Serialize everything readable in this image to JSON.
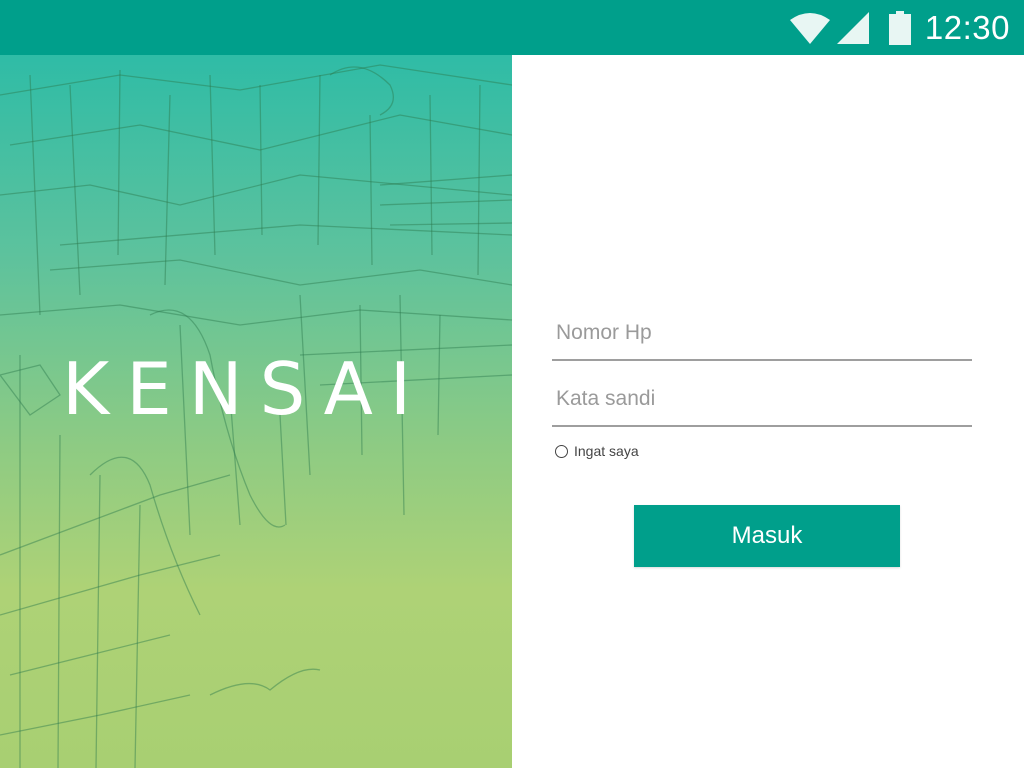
{
  "status_bar": {
    "time": "12:30",
    "icons": [
      "wifi-icon",
      "signal-icon",
      "battery-icon"
    ],
    "color": "#009f8b"
  },
  "hero": {
    "logo_text": "KENSAI",
    "gradient_colors": [
      "#2fbca6",
      "#aed276"
    ]
  },
  "login_form": {
    "phone_placeholder": "Nomor Hp",
    "password_placeholder": "Kata sandi",
    "remember_label": "Ingat saya",
    "remember_checked": false,
    "submit_label": "Masuk"
  },
  "colors": {
    "accent": "#009f8b",
    "field_underline": "#9e9e9e"
  }
}
